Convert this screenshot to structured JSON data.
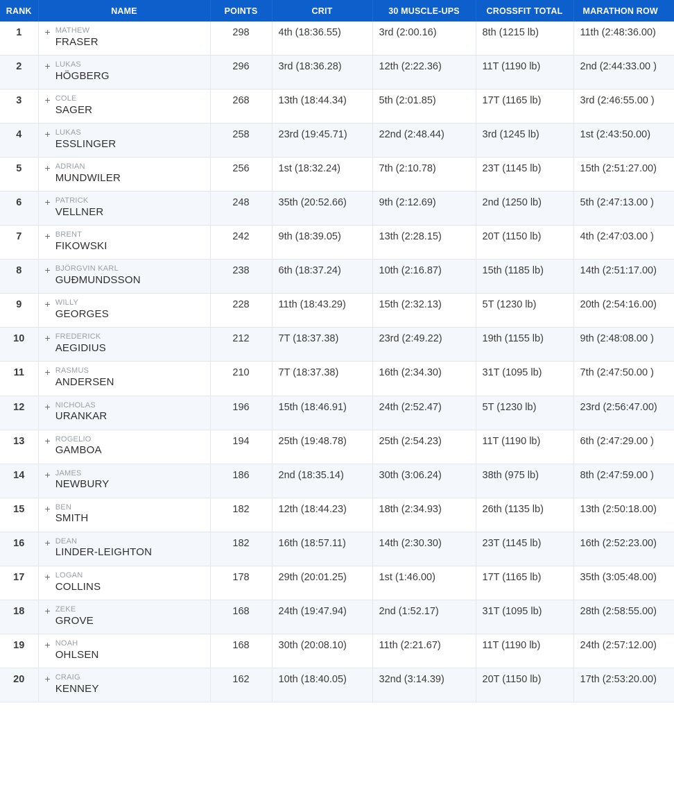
{
  "table": {
    "columns": [
      {
        "key": "rank",
        "label": "RANK"
      },
      {
        "key": "name",
        "label": "NAME"
      },
      {
        "key": "points",
        "label": "POINTS"
      },
      {
        "key": "crit",
        "label": "CRIT"
      },
      {
        "key": "muscleups",
        "label": "30 MUSCLE-UPS"
      },
      {
        "key": "total",
        "label": "CROSSFIT TOTAL"
      },
      {
        "key": "marathon",
        "label": "MARATHON ROW"
      }
    ],
    "expander_glyph": "+",
    "header_bg": "#0d5fcc",
    "stripe_bg": "#f4f7fb",
    "rows": [
      {
        "rank": "1",
        "first": "MATHEW",
        "last": "FRASER",
        "points": "298",
        "crit": "4th (18:36.55)",
        "muscleups": "3rd (2:00.16)",
        "total": "8th (1215 lb)",
        "marathon": "11th (2:48:36.00)"
      },
      {
        "rank": "2",
        "first": "LUKAS",
        "last": "HÖGBERG",
        "points": "296",
        "crit": "3rd (18:36.28)",
        "muscleups": "12th (2:22.36)",
        "total": "11T (1190 lb)",
        "marathon": "2nd (2:44:33.00 )"
      },
      {
        "rank": "3",
        "first": "COLE",
        "last": "SAGER",
        "points": "268",
        "crit": "13th (18:44.34)",
        "muscleups": "5th (2:01.85)",
        "total": "17T (1165 lb)",
        "marathon": "3rd (2:46:55.00 )"
      },
      {
        "rank": "4",
        "first": "LUKAS",
        "last": "ESSLINGER",
        "points": "258",
        "crit": "23rd (19:45.71)",
        "muscleups": "22nd (2:48.44)",
        "total": "3rd (1245 lb)",
        "marathon": "1st (2:43:50.00)"
      },
      {
        "rank": "5",
        "first": "ADRIAN",
        "last": "MUNDWILER",
        "points": "256",
        "crit": "1st (18:32.24)",
        "muscleups": "7th (2:10.78)",
        "total": "23T (1145 lb)",
        "marathon": "15th (2:51:27.00)"
      },
      {
        "rank": "6",
        "first": "PATRICK",
        "last": "VELLNER",
        "points": "248",
        "crit": "35th (20:52.66)",
        "muscleups": "9th (2:12.69)",
        "total": "2nd (1250 lb)",
        "marathon": "5th (2:47:13.00 )"
      },
      {
        "rank": "7",
        "first": "BRENT",
        "last": "FIKOWSKI",
        "points": "242",
        "crit": "9th (18:39.05)",
        "muscleups": "13th (2:28.15)",
        "total": "20T (1150 lb)",
        "marathon": "4th (2:47:03.00 )"
      },
      {
        "rank": "8",
        "first": "BJÖRGVIN KARL",
        "last": "GUÐMUNDSSON",
        "points": "238",
        "crit": "6th (18:37.24)",
        "muscleups": "10th (2:16.87)",
        "total": "15th (1185 lb)",
        "marathon": "14th (2:51:17.00)"
      },
      {
        "rank": "9",
        "first": "WILLY",
        "last": "GEORGES",
        "points": "228",
        "crit": "11th (18:43.29)",
        "muscleups": "15th (2:32.13)",
        "total": "5T (1230 lb)",
        "marathon": "20th (2:54:16.00)"
      },
      {
        "rank": "10",
        "first": "FREDERICK",
        "last": "AEGIDIUS",
        "points": "212",
        "crit": "7T (18:37.38)",
        "muscleups": "23rd (2:49.22)",
        "total": "19th (1155 lb)",
        "marathon": "9th (2:48:08.00 )"
      },
      {
        "rank": "11",
        "first": "RASMUS",
        "last": "ANDERSEN",
        "points": "210",
        "crit": "7T (18:37.38)",
        "muscleups": "16th (2:34.30)",
        "total": "31T (1095 lb)",
        "marathon": "7th (2:47:50.00 )"
      },
      {
        "rank": "12",
        "first": "NICHOLAS",
        "last": "URANKAR",
        "points": "196",
        "crit": "15th (18:46.91)",
        "muscleups": "24th (2:52.47)",
        "total": "5T (1230 lb)",
        "marathon": "23rd (2:56:47.00)"
      },
      {
        "rank": "13",
        "first": "ROGELIO",
        "last": "GAMBOA",
        "points": "194",
        "crit": "25th (19:48.78)",
        "muscleups": "25th (2:54.23)",
        "total": "11T (1190 lb)",
        "marathon": "6th (2:47:29.00 )"
      },
      {
        "rank": "14",
        "first": "JAMES",
        "last": "NEWBURY",
        "points": "186",
        "crit": "2nd (18:35.14)",
        "muscleups": "30th (3:06.24)",
        "total": "38th (975 lb)",
        "marathon": "8th (2:47:59.00 )"
      },
      {
        "rank": "15",
        "first": "BEN",
        "last": "SMITH",
        "points": "182",
        "crit": "12th (18:44.23)",
        "muscleups": "18th (2:34.93)",
        "total": "26th (1135 lb)",
        "marathon": "13th (2:50:18.00)"
      },
      {
        "rank": "16",
        "first": "DEAN",
        "last": "LINDER-LEIGHTON",
        "points": "182",
        "crit": "16th (18:57.11)",
        "muscleups": "14th (2:30.30)",
        "total": "23T (1145 lb)",
        "marathon": "16th (2:52:23.00)"
      },
      {
        "rank": "17",
        "first": "LOGAN",
        "last": "COLLINS",
        "points": "178",
        "crit": "29th (20:01.25)",
        "muscleups": "1st (1:46.00)",
        "total": "17T (1165 lb)",
        "marathon": "35th (3:05:48.00)"
      },
      {
        "rank": "18",
        "first": "ZEKE",
        "last": "GROVE",
        "points": "168",
        "crit": "24th (19:47.94)",
        "muscleups": "2nd (1:52.17)",
        "total": "31T (1095 lb)",
        "marathon": "28th (2:58:55.00)"
      },
      {
        "rank": "19",
        "first": "NOAH",
        "last": "OHLSEN",
        "points": "168",
        "crit": "30th (20:08.10)",
        "muscleups": "11th (2:21.67)",
        "total": "11T (1190 lb)",
        "marathon": "24th (2:57:12.00)"
      },
      {
        "rank": "20",
        "first": "CRAIG",
        "last": "KENNEY",
        "points": "162",
        "crit": "10th (18:40.05)",
        "muscleups": "32nd (3:14.39)",
        "total": "20T (1150 lb)",
        "marathon": "17th (2:53:20.00)"
      }
    ]
  }
}
